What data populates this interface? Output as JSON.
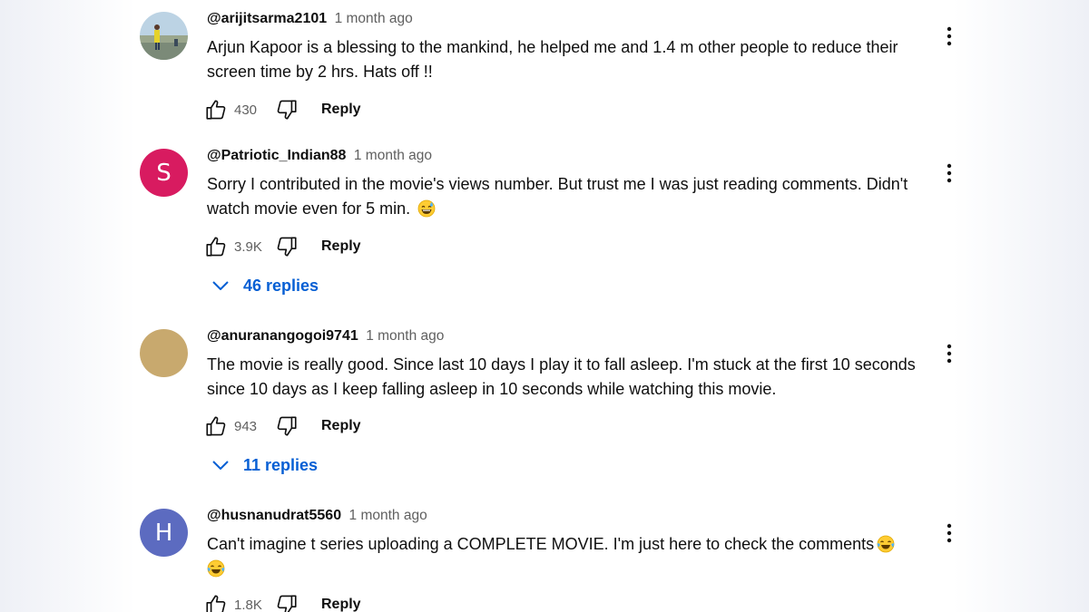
{
  "comments": [
    {
      "author": "@arijitsarma2101",
      "time": "1 month ago",
      "text": "Arjun Kapoor is a blessing to the mankind, he helped me and 1.4 m other people to reduce their screen time by 2 hrs. Hats off !!",
      "likes": "430",
      "reply_label": "Reply",
      "avatar_type": "photo"
    },
    {
      "author": "@Patriotic_Indian88",
      "time": "1 month ago",
      "text": "Sorry I contributed in the movie's views number. But trust me I was just reading comments. Didn't watch movie even for 5 min.",
      "emoji": "grinning-sweat",
      "likes": "3.9K",
      "reply_label": "Reply",
      "avatar_letter": "S",
      "avatar_color": "#d81b60",
      "replies_label": "46 replies"
    },
    {
      "author": "@anuranangogoi9741",
      "time": "1 month ago",
      "text": "The movie is really good. Since last 10 days I play it to fall asleep. I'm stuck at the first 10 seconds since 10 days as I keep falling asleep in 10 seconds while watching this movie.",
      "likes": "943",
      "reply_label": "Reply",
      "avatar_color": "#c8a96e",
      "replies_label": "11 replies"
    },
    {
      "author": "@husnanudrat5560",
      "time": "1 month ago",
      "text": "Can't imagine t series uploading a COMPLETE MOVIE. I'm just here to check the comments",
      "emoji": "tears-of-joy",
      "emoji_count": 2,
      "likes": "1.8K",
      "reply_label": "Reply",
      "avatar_letter": "H",
      "avatar_color": "#5c6bc0"
    }
  ],
  "colors": {
    "link": "#065fd4",
    "secondary_text": "#606060",
    "primary_text": "#0f0f0f"
  },
  "icons": [
    "like-icon",
    "dislike-icon",
    "more-options-icon",
    "chevron-down-icon"
  ]
}
